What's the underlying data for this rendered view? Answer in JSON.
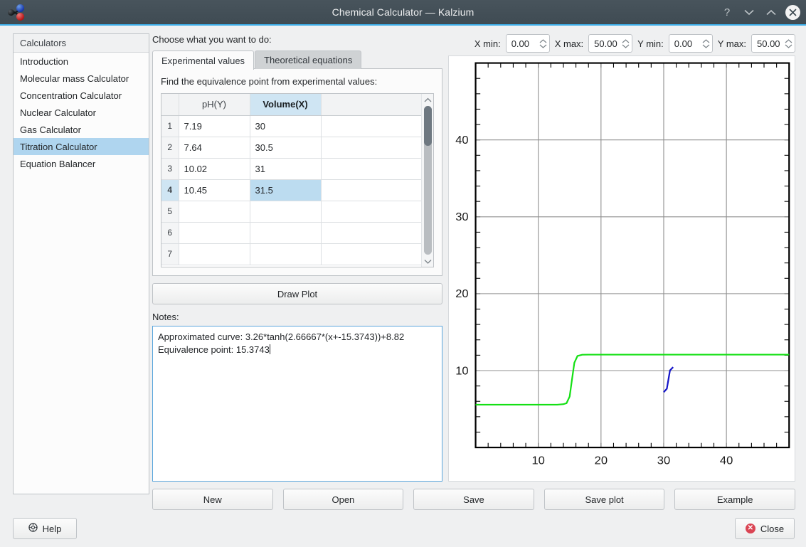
{
  "window": {
    "title": "Chemical Calculator — Kalzium",
    "icon": "molecule-icon",
    "controls": [
      {
        "name": "help-button",
        "glyph": "?"
      },
      {
        "name": "minimize-button",
        "glyph": "v"
      },
      {
        "name": "maximize-button",
        "glyph": "^"
      },
      {
        "name": "close-button",
        "glyph": "✕"
      }
    ]
  },
  "sidebar": {
    "header": "Calculators",
    "items": [
      {
        "label": "Introduction",
        "selected": false
      },
      {
        "label": "Molecular mass Calculator",
        "selected": false
      },
      {
        "label": "Concentration Calculator",
        "selected": false
      },
      {
        "label": "Nuclear Calculator",
        "selected": false
      },
      {
        "label": "Gas Calculator",
        "selected": false
      },
      {
        "label": "Titration Calculator",
        "selected": true
      },
      {
        "label": "Equation Balancer",
        "selected": false
      }
    ]
  },
  "main": {
    "choose_label": "Choose what you want to do:",
    "tabs": [
      {
        "label": "Experimental values",
        "active": true
      },
      {
        "label": "Theoretical equations",
        "active": false
      }
    ],
    "panel_hint": "Find the equivalence point from experimental values:",
    "table": {
      "columns": [
        "pH(Y)",
        "Volume(X)"
      ],
      "selected_column": "Volume(X)",
      "selected_row": 4,
      "rows": [
        {
          "n": "1",
          "ph": "7.19",
          "volume": "30"
        },
        {
          "n": "2",
          "ph": "7.64",
          "volume": "30.5"
        },
        {
          "n": "3",
          "ph": "10.02",
          "volume": "31"
        },
        {
          "n": "4",
          "ph": "10.45",
          "volume": "31.5"
        },
        {
          "n": "5",
          "ph": "",
          "volume": ""
        },
        {
          "n": "6",
          "ph": "",
          "volume": ""
        },
        {
          "n": "7",
          "ph": "",
          "volume": ""
        }
      ]
    },
    "draw_plot_label": "Draw Plot",
    "notes_label": "Notes:",
    "notes_value": "Approximated curve: 3.26*tanh(2.66667*(x+-15.3743))+8.82\nEquivalence point: 15.3743"
  },
  "axes": {
    "fields": [
      {
        "label": "X min:",
        "value": "0.00",
        "name": "x-min-spinbox"
      },
      {
        "label": "X max:",
        "value": "50.00",
        "name": "x-max-spinbox"
      },
      {
        "label": "Y min:",
        "value": "0.00",
        "name": "y-min-spinbox"
      },
      {
        "label": "Y max:",
        "value": "50.00",
        "name": "y-max-spinbox"
      }
    ]
  },
  "action_buttons": [
    {
      "label": "New",
      "name": "new-button"
    },
    {
      "label": "Open",
      "name": "open-button"
    },
    {
      "label": "Save",
      "name": "save-button"
    },
    {
      "label": "Save plot",
      "name": "save-plot-button"
    },
    {
      "label": "Example",
      "name": "example-button"
    }
  ],
  "footer": {
    "help_label": "Help",
    "close_label": "Close"
  },
  "colors": {
    "titlebar": "#3f4b53",
    "accent": "#3daee9",
    "selection": "#afd5ef",
    "cell_selection": "#bcdcf0",
    "curve_green": "#14e014",
    "data_blue": "#1414c8",
    "close_red": "#da4453"
  },
  "chart_data": {
    "type": "line",
    "title": "",
    "xlabel": "",
    "ylabel": "",
    "xlim": [
      0,
      50
    ],
    "ylim": [
      0,
      50
    ],
    "grid": true,
    "xticks": [
      10,
      20,
      30,
      40
    ],
    "yticks": [
      10,
      20,
      30,
      40
    ],
    "minor_tick_step": 2,
    "legend": "none",
    "series": [
      {
        "name": "Approximated curve 3.26*tanh(2.66667*(x+-15.3743))+8.82",
        "color": "#14e014",
        "x": [
          0,
          2,
          4,
          6,
          8,
          10,
          12,
          13,
          14,
          14.5,
          15,
          15.37,
          15.75,
          16.25,
          17,
          18,
          20,
          25,
          30,
          35,
          40,
          45,
          50
        ],
        "y": [
          5.56,
          5.56,
          5.56,
          5.56,
          5.56,
          5.56,
          5.56,
          5.57,
          5.63,
          5.76,
          6.63,
          8.82,
          11.02,
          11.9,
          12.06,
          12.08,
          12.08,
          12.08,
          12.08,
          12.08,
          12.08,
          12.08,
          12.08
        ]
      },
      {
        "name": "Experimental values",
        "color": "#1414c8",
        "x": [
          30,
          30.5,
          31,
          31.5
        ],
        "y": [
          7.19,
          7.64,
          10.02,
          10.45
        ]
      }
    ]
  }
}
